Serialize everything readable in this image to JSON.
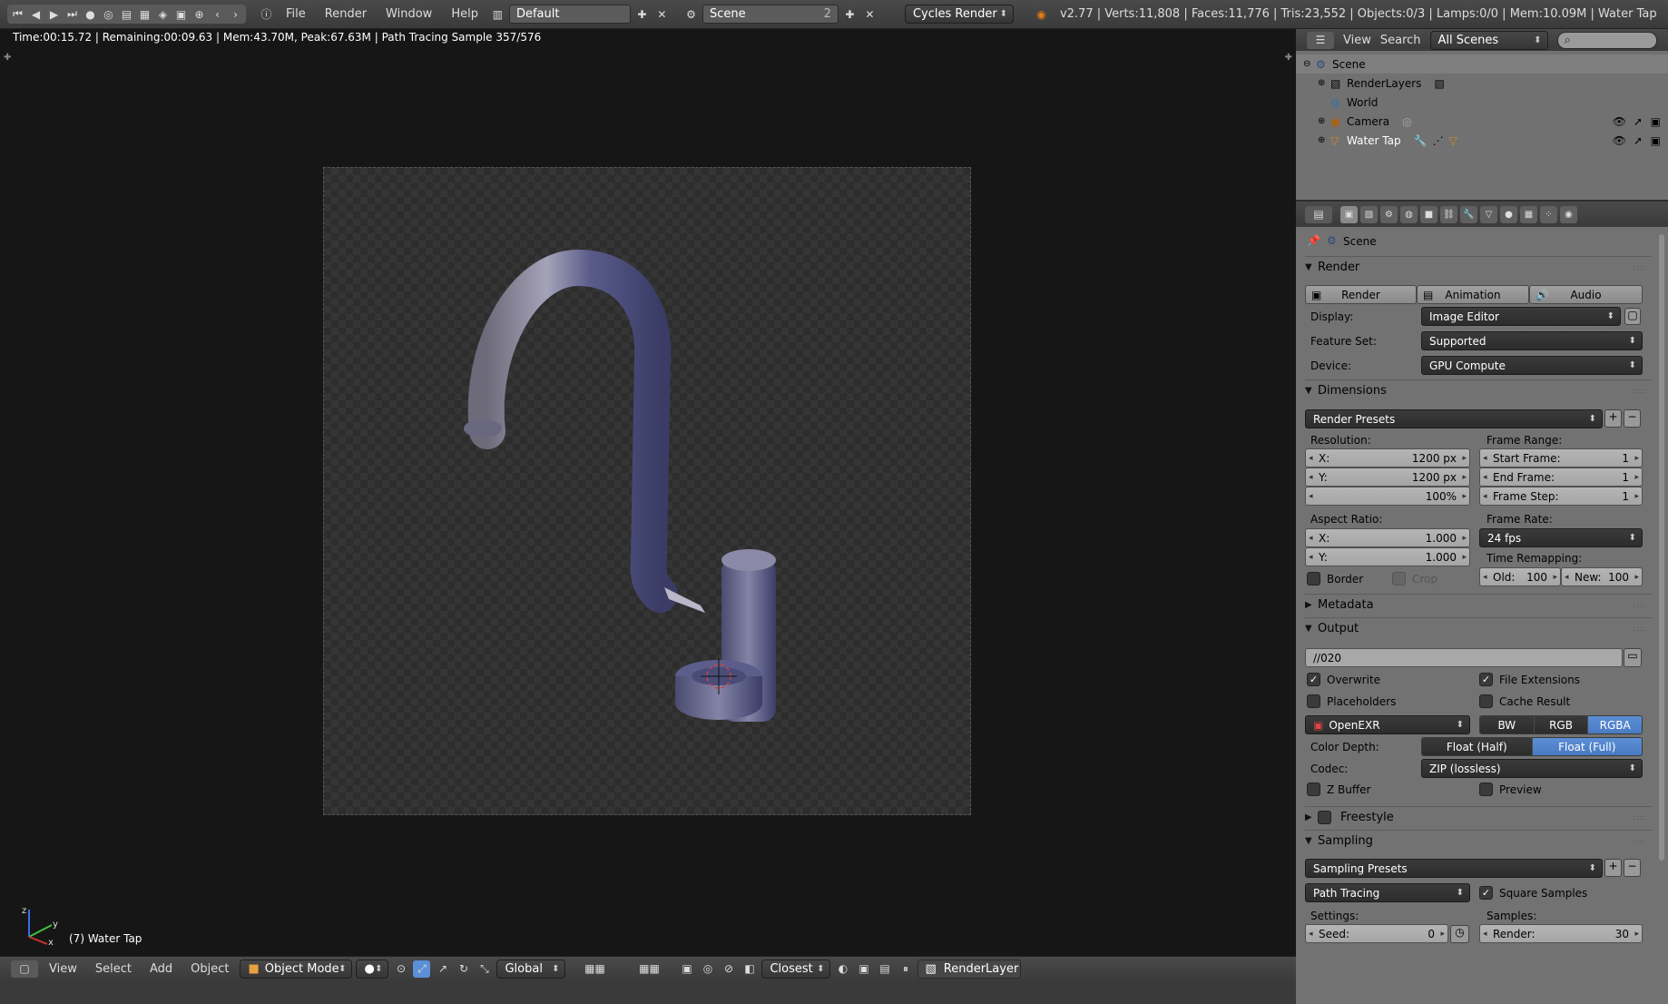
{
  "topbar": {
    "menus": [
      "File",
      "Render",
      "Window",
      "Help"
    ],
    "layout": "Default",
    "scene": "Scene",
    "scene_users": "2",
    "engine": "Cycles Render",
    "stats": "v2.77 | Verts:11,808 | Faces:11,776 | Tris:23,552 | Objects:0/3 | Lamps:0/0 | Mem:10.09M | Water Tap"
  },
  "viewport": {
    "render_info": "Time:00:15.72 | Remaining:00:09.63 | Mem:43.70M, Peak:67.63M | Path Tracing Sample 357/576",
    "object_label": "(7) Water Tap",
    "axis_labels": {
      "x": "x",
      "y": "y",
      "z": "z"
    }
  },
  "bottombar": {
    "menus": [
      "View",
      "Select",
      "Add",
      "Object"
    ],
    "mode": "Object Mode",
    "orientation": "Global",
    "snap": "Closest",
    "render_layer": "RenderLayer"
  },
  "outliner": {
    "view": "View",
    "search": "Search",
    "filter": "All Scenes",
    "items": [
      {
        "name": "Scene"
      },
      {
        "name": "RenderLayers"
      },
      {
        "name": "World"
      },
      {
        "name": "Camera"
      },
      {
        "name": "Water Tap"
      }
    ]
  },
  "properties": {
    "context": "Scene",
    "render": {
      "title": "Render",
      "buttons": [
        "Render",
        "Animation",
        "Audio"
      ],
      "display_label": "Display:",
      "display": "Image Editor",
      "feature_label": "Feature Set:",
      "feature": "Supported",
      "device_label": "Device:",
      "device": "GPU Compute"
    },
    "dimensions": {
      "title": "Dimensions",
      "presets": "Render Presets",
      "resolution_label": "Resolution:",
      "res_x_label": "X:",
      "res_x": "1200 px",
      "res_y_label": "Y:",
      "res_y": "1200 px",
      "res_pct": "100%",
      "frame_range_label": "Frame Range:",
      "start_label": "Start Frame:",
      "start": "1",
      "end_label": "End Frame:",
      "end": "1",
      "step_label": "Frame Step:",
      "step": "1",
      "aspect_label": "Aspect Ratio:",
      "asp_x_label": "X:",
      "asp_x": "1.000",
      "asp_y_label": "Y:",
      "asp_y": "1.000",
      "frame_rate_label": "Frame Rate:",
      "frame_rate": "24 fps",
      "remap_label": "Time Remapping:",
      "old_label": "Old:",
      "old": "100",
      "new_label": "New:",
      "new": "100",
      "border": "Border",
      "crop": "Crop"
    },
    "metadata": {
      "title": "Metadata"
    },
    "output": {
      "title": "Output",
      "path": "//020",
      "overwrite": "Overwrite",
      "file_ext": "File Extensions",
      "placeholders": "Placeholders",
      "cache": "Cache Result",
      "format": "OpenEXR",
      "channels": [
        "BW",
        "RGB",
        "RGBA"
      ],
      "depth_label": "Color Depth:",
      "depths": [
        "Float (Half)",
        "Float (Full)"
      ],
      "codec_label": "Codec:",
      "codec": "ZIP (lossless)",
      "zbuffer": "Z Buffer",
      "preview": "Preview"
    },
    "freestyle": {
      "title": "Freestyle"
    },
    "sampling": {
      "title": "Sampling",
      "presets": "Sampling Presets",
      "integrator": "Path Tracing",
      "square": "Square Samples",
      "settings_label": "Settings:",
      "seed_label": "Seed:",
      "seed": "0",
      "samples_label": "Samples:",
      "render_label": "Render:",
      "render": "30"
    }
  },
  "colors": {
    "accent": "#5b8fd6",
    "viewport_bg": "#161616",
    "panel_bg": "#727272"
  }
}
